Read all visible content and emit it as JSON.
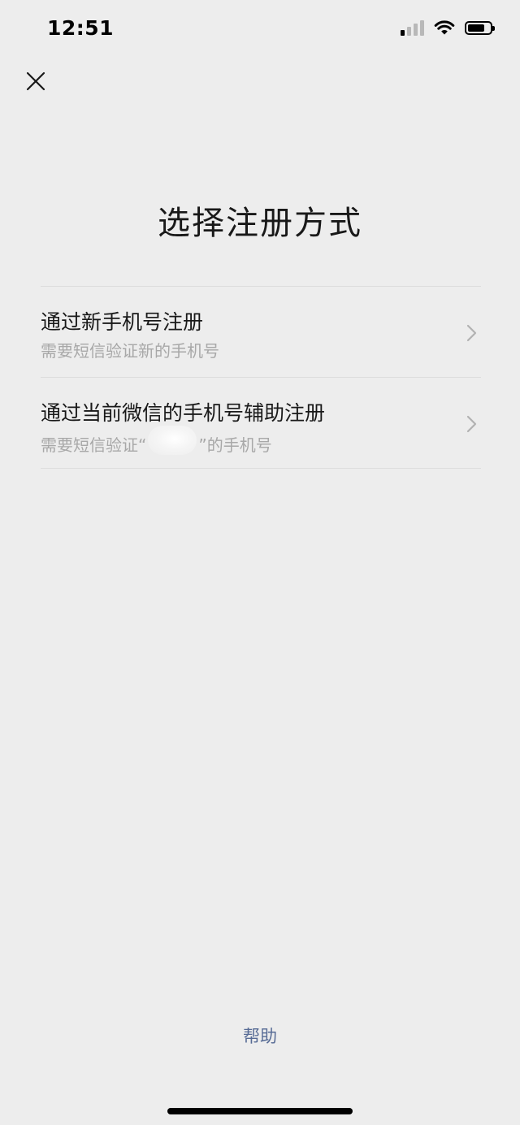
{
  "status_bar": {
    "time": "12:51",
    "signal_bars_active": 1,
    "signal_bars_total": 4,
    "battery_level_percent": 75,
    "icons": [
      "signal-icon",
      "wifi-icon",
      "battery-icon"
    ]
  },
  "header": {
    "close_icon": "close-icon"
  },
  "page": {
    "title": "选择注册方式"
  },
  "options": [
    {
      "title": "通过新手机号注册",
      "description": "需要短信验证新的手机号",
      "icon": "chevron-right-icon"
    },
    {
      "title": "通过当前微信的手机号辅助注册",
      "description_prefix": "需要短信验证“",
      "description_suffix": "”的手机号",
      "icon": "chevron-right-icon"
    }
  ],
  "footer": {
    "help_label": "帮助"
  },
  "colors": {
    "background": "#ededed",
    "link": "#576b95",
    "primary_text": "#191919",
    "secondary_text": "#a8a8a8",
    "divider": "#dcdcdc"
  }
}
